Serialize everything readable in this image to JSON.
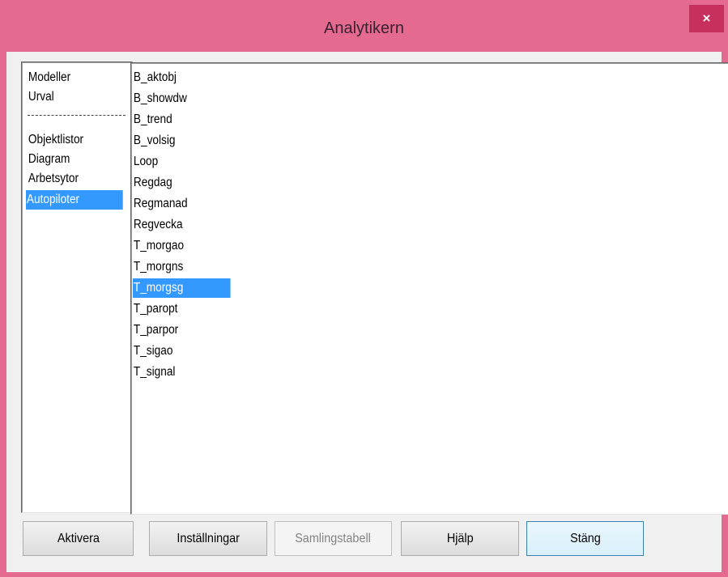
{
  "window": {
    "title": "Analytikern",
    "close_glyph": "×"
  },
  "categories": {
    "items": [
      "Modeller",
      "Urval",
      "Objektlistor",
      "Diagram",
      "Arbetsytor",
      "Autopiloter"
    ],
    "selected": "Autopiloter"
  },
  "entries": {
    "items": [
      "B_aktobj",
      "B_showdw",
      "B_trend",
      "B_volsig",
      "Loop",
      "Regdag",
      "Regmanad",
      "Regvecka",
      "T_morgao",
      "T_morgns",
      "T_morgsg",
      "T_paropt",
      "T_parpor",
      "T_sigao",
      "T_signal"
    ],
    "selected": "T_morgsg"
  },
  "buttons": {
    "activate": "Aktivera",
    "settings": "Inställningar",
    "collection_table": "Samlingstabell",
    "help": "Hjälp",
    "close": "Stäng"
  },
  "colors": {
    "titlebar": "#e46a8f",
    "close_button": "#c7305c",
    "selection": "#3399ff"
  }
}
